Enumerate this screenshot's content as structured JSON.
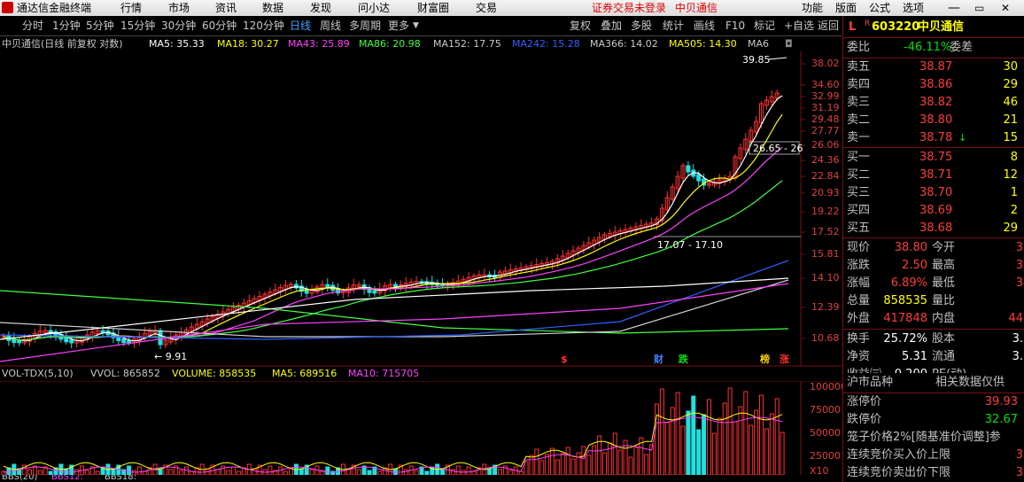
{
  "topbar": {
    "app_title": "通达信金融终端",
    "menus": [
      "行情",
      "市场",
      "资讯",
      "数据",
      "发现",
      "问小达",
      "财富圈",
      "交易"
    ],
    "notice": "证券交易未登录",
    "stock_name": "中贝通信",
    "right_menus": [
      "功能",
      "版面",
      "公式",
      "选项"
    ]
  },
  "toolbar": {
    "periods": [
      "分时",
      "1分钟",
      "5分钟",
      "15分钟",
      "30分钟",
      "60分钟",
      "120分钟",
      "日线",
      "周线",
      "多周期",
      "更多"
    ],
    "active_period": "日线",
    "actions": [
      "复权",
      "叠加",
      "多股",
      "统计",
      "画线",
      "F10",
      "标记",
      "+自选",
      "返回"
    ]
  },
  "chart": {
    "title": "中贝通信(日线 前复权 对数)",
    "ma_labels": [
      {
        "text": "MA5: 35.33",
        "color": "#ffffff"
      },
      {
        "text": "MA18: 30.27",
        "color": "#ffff00"
      },
      {
        "text": "MA43: 25.89",
        "color": "#ff40ff"
      },
      {
        "text": "MA86: 20.98",
        "color": "#40ff40"
      },
      {
        "text": "MA152: 17.75",
        "color": "#c8c8c8"
      },
      {
        "text": "MA242: 15.28",
        "color": "#3060ff"
      },
      {
        "text": "MA366: 14.02",
        "color": "#c8c8c8"
      },
      {
        "text": "MA505: 14.30",
        "color": "#ffff00"
      },
      {
        "text": "MA6",
        "color": "#c8c8c8"
      }
    ],
    "price_ticks": [
      "38.02",
      "34.60",
      "32.99",
      "31.19",
      "29.48",
      "27.77",
      "26.06",
      "24.36",
      "22.84",
      "20.93",
      "19.22",
      "17.52",
      "15.81",
      "14.10",
      "12.39",
      "10.68"
    ],
    "annotations": {
      "high": "39.85",
      "low": "9.91",
      "range1": "26.65 - 26",
      "range2": "17.07 - 17.10"
    },
    "event_marks": [
      {
        "text": "$",
        "color": "#ff3030"
      },
      {
        "text": "财",
        "color": "#4080ff"
      },
      {
        "text": "跌",
        "color": "#00e000"
      },
      {
        "text": "榜",
        "color": "#ffd000"
      },
      {
        "text": "涨",
        "color": "#ff3030"
      }
    ]
  },
  "volume": {
    "labels": [
      {
        "text": "VOL-TDX(5,10)",
        "color": "#c8c8c8"
      },
      {
        "text": "VVOL: 865852",
        "color": "#c8c8c8"
      },
      {
        "text": "VOLUME: 858535",
        "color": "#ffff00"
      },
      {
        "text": "MA5: 689516",
        "color": "#ffff00"
      },
      {
        "text": "MA10: 715705",
        "color": "#ff40ff"
      }
    ],
    "ticks": [
      "100000",
      "75000",
      "50000",
      "25000",
      "X10"
    ]
  },
  "bottom": {
    "labels": [
      "BBS(20)",
      "BBS12:",
      "BBS18:"
    ]
  },
  "panel": {
    "code": "603220",
    "name": "中贝通信",
    "prefix": "L",
    "committee": {
      "label": "委比",
      "value": "-46.11%",
      "diff_label": "委差"
    },
    "asks": [
      {
        "label": "卖五",
        "price": "38.87",
        "vol": "30"
      },
      {
        "label": "卖四",
        "price": "38.86",
        "vol": "29"
      },
      {
        "label": "卖三",
        "price": "38.82",
        "vol": "46"
      },
      {
        "label": "卖二",
        "price": "38.80",
        "vol": "21"
      },
      {
        "label": "卖一",
        "price": "38.78",
        "vol": "15"
      }
    ],
    "bids": [
      {
        "label": "买一",
        "price": "38.75",
        "vol": "8"
      },
      {
        "label": "买二",
        "price": "38.71",
        "vol": "12"
      },
      {
        "label": "买三",
        "price": "38.70",
        "vol": "1"
      },
      {
        "label": "买四",
        "price": "38.69",
        "vol": "2"
      },
      {
        "label": "买五",
        "price": "38.68",
        "vol": "29"
      }
    ],
    "stats": [
      {
        "l1": "现价",
        "v1": "38.80",
        "c1": "red",
        "l2": "今开",
        "v2": "3"
      },
      {
        "l1": "涨跌",
        "v1": "2.50",
        "c1": "red",
        "l2": "最高",
        "v2": "3"
      },
      {
        "l1": "涨幅",
        "v1": "6.89%",
        "c1": "red",
        "l2": "最低",
        "v2": "3"
      },
      {
        "l1": "总量",
        "v1": "858535",
        "c1": "yel",
        "l2": "量比",
        "v2": ""
      },
      {
        "l1": "外盘",
        "v1": "417848",
        "c1": "red",
        "l2": "内盘",
        "v2": "44"
      }
    ],
    "stats2": [
      {
        "l1": "换手",
        "v1": "25.72%",
        "l2": "股本",
        "v2": "3."
      },
      {
        "l1": "净资",
        "v1": "5.31",
        "l2": "流通",
        "v2": "3."
      },
      {
        "l1": "收益㈢",
        "v1": "0.200",
        "l2": "PE(动)",
        "v2": ""
      }
    ],
    "section_title": "沪市品种",
    "section_note": "相关数据仅供",
    "limits": [
      {
        "label": "涨停价",
        "value": "39.93",
        "color": "red"
      },
      {
        "label": "跌停价",
        "value": "32.67",
        "color": "grn"
      }
    ],
    "rules": [
      {
        "label": "笼子价格2%[随基准价调整]参",
        "value": ""
      },
      {
        "label": "连续竞价买入价上限",
        "value": "3"
      },
      {
        "label": "连续竞价卖出价下限",
        "value": "3"
      }
    ]
  }
}
